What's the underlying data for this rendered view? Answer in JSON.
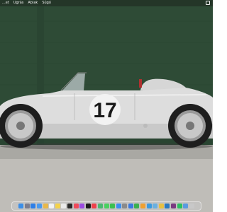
{
  "menubar": {
    "items": [
      "...et",
      "Ugrás",
      "Ablak",
      "Súgó"
    ],
    "control_center_icon": "control-center-icon"
  },
  "wallpaper": {
    "race_number": "17",
    "wall_color": "#2d4a35",
    "car_color": "#dcdcdc"
  },
  "dock": {
    "icons": [
      {
        "name": "finder-icon",
        "color": "#3b8ee8"
      },
      {
        "name": "launchpad-icon",
        "color": "#7c7c8c"
      },
      {
        "name": "safari-icon",
        "color": "#2e7fe8"
      },
      {
        "name": "mail-icon",
        "color": "#4a9af0"
      },
      {
        "name": "photos-icon",
        "color": "#e8b84a"
      },
      {
        "name": "calendar-icon",
        "color": "#f2f2f2"
      },
      {
        "name": "notes-icon",
        "color": "#f4d24a"
      },
      {
        "name": "reminders-icon",
        "color": "#eaeaea"
      },
      {
        "name": "terminal-icon",
        "color": "#2a2a2a"
      },
      {
        "name": "music-icon",
        "color": "#f04a5a"
      },
      {
        "name": "podcasts-icon",
        "color": "#9a4ae0"
      },
      {
        "name": "tv-icon",
        "color": "#1a1a1a"
      },
      {
        "name": "news-icon",
        "color": "#f0404a"
      },
      {
        "name": "maps-icon",
        "color": "#4ab870"
      },
      {
        "name": "messages-icon",
        "color": "#4ad060"
      },
      {
        "name": "facetime-icon",
        "color": "#3ac050"
      },
      {
        "name": "appstore-icon",
        "color": "#3a8ef0"
      },
      {
        "name": "settings-icon",
        "color": "#8a8a8a"
      },
      {
        "name": "keynote-icon",
        "color": "#3a7ae0"
      },
      {
        "name": "numbers-icon",
        "color": "#3ab050"
      },
      {
        "name": "pages-icon",
        "color": "#f0a030"
      },
      {
        "name": "xcode-icon",
        "color": "#3a9ae0"
      },
      {
        "name": "preview-icon",
        "color": "#6ab0e0"
      },
      {
        "name": "chrome-icon",
        "color": "#e8c040"
      },
      {
        "name": "vscode-icon",
        "color": "#2a7ac0"
      },
      {
        "name": "slack-icon",
        "color": "#7a3a80"
      },
      {
        "name": "spotify-icon",
        "color": "#2ac060"
      },
      {
        "name": "downloads-icon",
        "color": "#5a9ae0"
      },
      {
        "name": "trash-icon",
        "color": "#c8c8c8"
      }
    ]
  }
}
